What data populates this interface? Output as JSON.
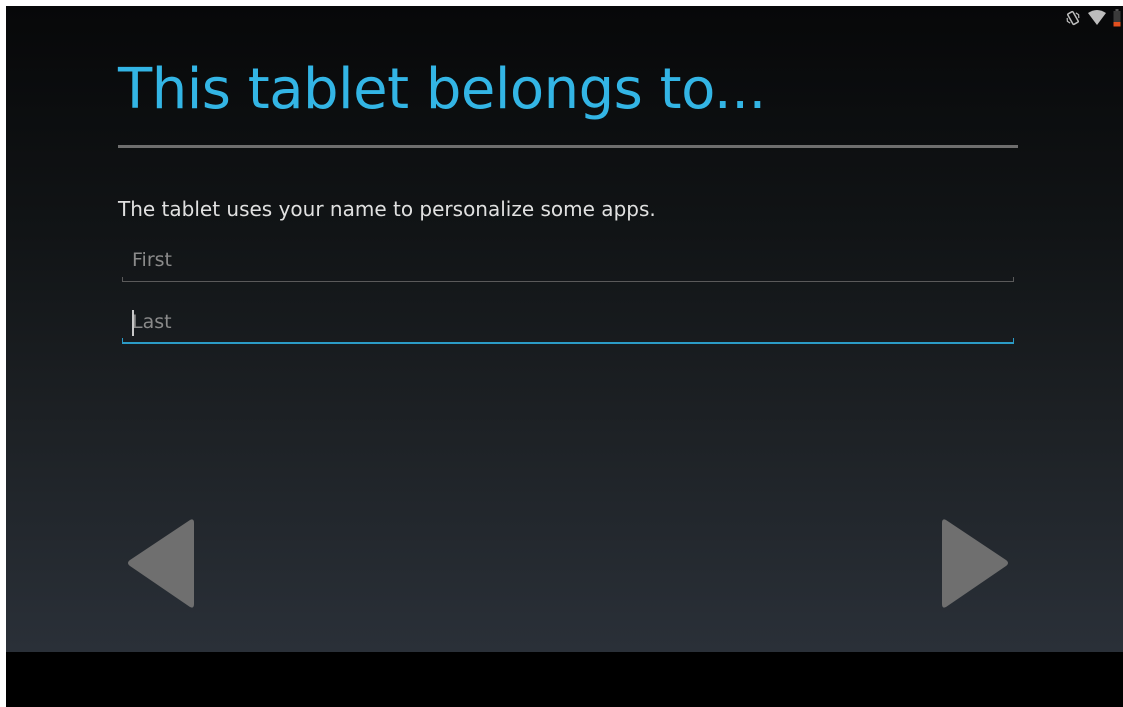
{
  "colors": {
    "accent": "#33b5e5",
    "focus_line": "#2b9bc6",
    "arrow": "#6f6f6f",
    "battery": "#e2501f"
  },
  "status_bar": {
    "icons": [
      "vibrate-icon",
      "wifi-icon",
      "battery-icon"
    ],
    "battery_state": "low"
  },
  "header": {
    "title": "This tablet belongs to..."
  },
  "main": {
    "description": "The tablet uses your name to personalize some apps.",
    "first_name": {
      "placeholder": "First",
      "value": ""
    },
    "last_name": {
      "placeholder": "Last",
      "value": "",
      "focused": true
    }
  },
  "navigation": {
    "back_icon": "triangle-left-icon",
    "next_icon": "triangle-right-icon"
  }
}
